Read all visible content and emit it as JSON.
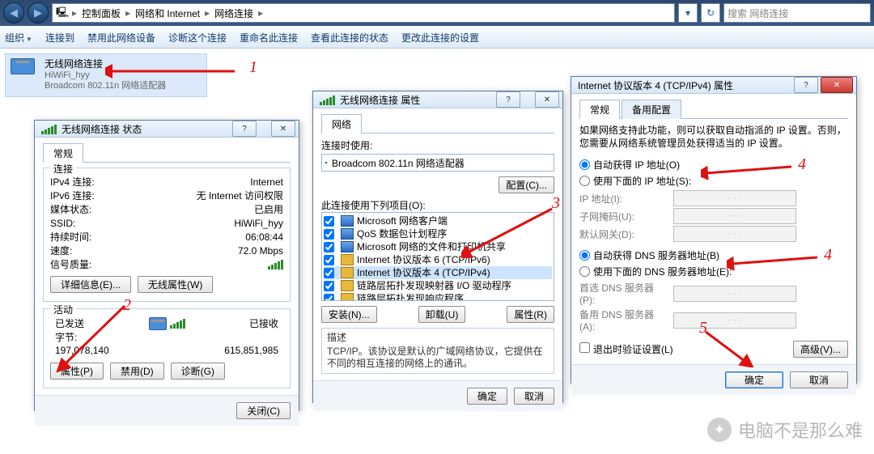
{
  "explorer": {
    "path_segments": [
      "控制面板",
      "网络和 Internet",
      "网络连接"
    ],
    "search_placeholder": "搜索 网络连接",
    "commands": [
      "组织",
      "连接到",
      "禁用此网络设备",
      "诊断这个连接",
      "重命名此连接",
      "查看此连接的状态",
      "更改此连接的设置"
    ],
    "conn": {
      "name": "无线网络连接",
      "ssid": "HiWiFi_hyy",
      "adapter": "Broadcom 802.11n 网络适配器"
    }
  },
  "status_win": {
    "title": "无线网络连接 状态",
    "tab": "常规",
    "section_conn": "连接",
    "rows": {
      "ipv4_k": "IPv4 连接:",
      "ipv4_v": "Internet",
      "ipv6_k": "IPv6 连接:",
      "ipv6_v": "无 Internet 访问权限",
      "media_k": "媒体状态:",
      "media_v": "已启用",
      "ssid_k": "SSID:",
      "ssid_v": "HiWiFi_hyy",
      "dur_k": "持续时间:",
      "dur_v": "06:08:44",
      "speed_k": "速度:",
      "speed_v": "72.0 Mbps",
      "sig_k": "信号质量:"
    },
    "btn_detail": "详细信息(E)...",
    "btn_wlan": "无线属性(W)",
    "section_act": "活动",
    "sent_label": "已发送",
    "recv_label": "已接收",
    "bytes_label": "字节:",
    "sent_bytes": "197,078,140",
    "recv_bytes": "615,851,985",
    "btn_prop": "属性(P)",
    "btn_disable": "禁用(D)",
    "btn_diag": "诊断(G)",
    "btn_close": "关闭(C)"
  },
  "prop_win": {
    "title": "无线网络连接 属性",
    "tab": "网络",
    "connect_using": "连接时使用:",
    "adapter": "Broadcom 802.11n 网络适配器",
    "btn_cfg": "配置(C)...",
    "uses_label": "此连接使用下列项目(O):",
    "items": [
      "Microsoft 网络客户端",
      "QoS 数据包计划程序",
      "Microsoft 网络的文件和打印机共享",
      "Internet 协议版本 6 (TCP/IPv6)",
      "Internet 协议版本 4 (TCP/IPv4)",
      "链路层拓扑发现映射器 I/O 驱动程序",
      "链路层拓扑发现响应程序"
    ],
    "btn_install": "安装(N)...",
    "btn_uninstall": "卸载(U)",
    "btn_props": "属性(R)",
    "desc_label": "描述",
    "desc_text": "TCP/IP。该协议是默认的广域网络协议，它提供在不同的相互连接的网络上的通讯。",
    "ok": "确定",
    "cancel": "取消"
  },
  "ipv4_win": {
    "title": "Internet 协议版本 4 (TCP/IPv4) 属性",
    "tab_general": "常规",
    "tab_alt": "备用配置",
    "intro": "如果网络支持此功能，则可以获取自动指派的 IP 设置。否则，您需要从网络系统管理员处获得适当的 IP 设置。",
    "r_auto_ip": "自动获得 IP 地址(O)",
    "r_man_ip": "使用下面的 IP 地址(S):",
    "f_ip": "IP 地址(I):",
    "f_mask": "子网掩码(U):",
    "f_gw": "默认网关(D):",
    "r_auto_dns": "自动获得 DNS 服务器地址(B)",
    "r_man_dns": "使用下面的 DNS 服务器地址(E):",
    "f_dns1": "首选 DNS 服务器(P):",
    "f_dns2": "备用 DNS 服务器(A):",
    "chk_validate": "退出时验证设置(L)",
    "btn_adv": "高级(V)...",
    "ok": "确定",
    "cancel": "取消"
  },
  "annot": {
    "n1": "1",
    "n2": "2",
    "n3": "3",
    "n4": "4",
    "n4b": "4",
    "n5": "5"
  },
  "watermark": "电脑不是那么难"
}
